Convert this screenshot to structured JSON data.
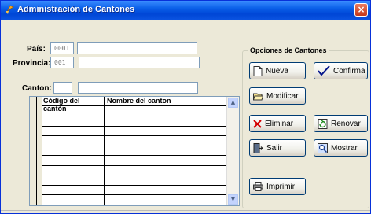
{
  "window": {
    "title": "Administración de Cantones",
    "close_label": "×"
  },
  "form": {
    "pais_label": "País:",
    "pais_code": "0001",
    "pais_name": "",
    "provincia_label": "Provincia:",
    "provincia_code": "001",
    "provincia_name": "",
    "canton_label": "Canton:",
    "canton_code": "",
    "canton_name": ""
  },
  "grid": {
    "columns": [
      "Código del cantón",
      "Nombre del canton"
    ],
    "rows": 10
  },
  "options": {
    "title": "Opciones de Cantones",
    "nueva": "Nueva",
    "confirma": "Confirma",
    "modificar": "Modificar",
    "eliminar": "Eliminar",
    "renovar": "Renovar",
    "salir": "Salir",
    "mostrar": "Mostrar",
    "imprimir": "Imprimir"
  }
}
